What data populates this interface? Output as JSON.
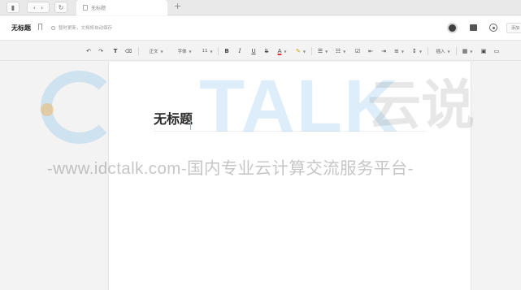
{
  "tabs": {
    "active_tab_title": "无标题",
    "add_tab_glyph": "+",
    "back_glyph": "‹",
    "forward_glyph": "›",
    "reload_glyph": "↻",
    "sidebar_glyph": "▮"
  },
  "titlebar": {
    "title": "无标题",
    "save_status": "暂时更新，文档将自动保存",
    "more_label": "添加"
  },
  "toolbar": {
    "undo": "↶",
    "redo": "↷",
    "format_painter": "T",
    "clear_format": "⌫",
    "paragraph_style": "正文",
    "font_family": "字体",
    "font_size": "11",
    "bold": "B",
    "italic": "I",
    "underline": "U",
    "strikethrough": "S",
    "font_color": "A",
    "highlight": "✎",
    "ordered_list": "☰",
    "unordered_list": "☷",
    "checklist": "☑",
    "indent_decrease": "⇤",
    "indent_increase": "⇥",
    "align": "≡",
    "line_spacing": "↕",
    "insert": "插入",
    "table": "▦",
    "image": "▣",
    "comment": "▭"
  },
  "editor": {
    "heading": "无标题"
  },
  "watermark": {
    "talk": "TALK",
    "cloud": "云说",
    "subtitle": "-www.idctalk.com-国内专业云计算交流服务平台-"
  },
  "colors": {
    "watermark_blue": "#54aae8",
    "watermark_orange": "#f5af46",
    "page_bg": "#ffffff",
    "app_bg": "#f3f3f3"
  }
}
